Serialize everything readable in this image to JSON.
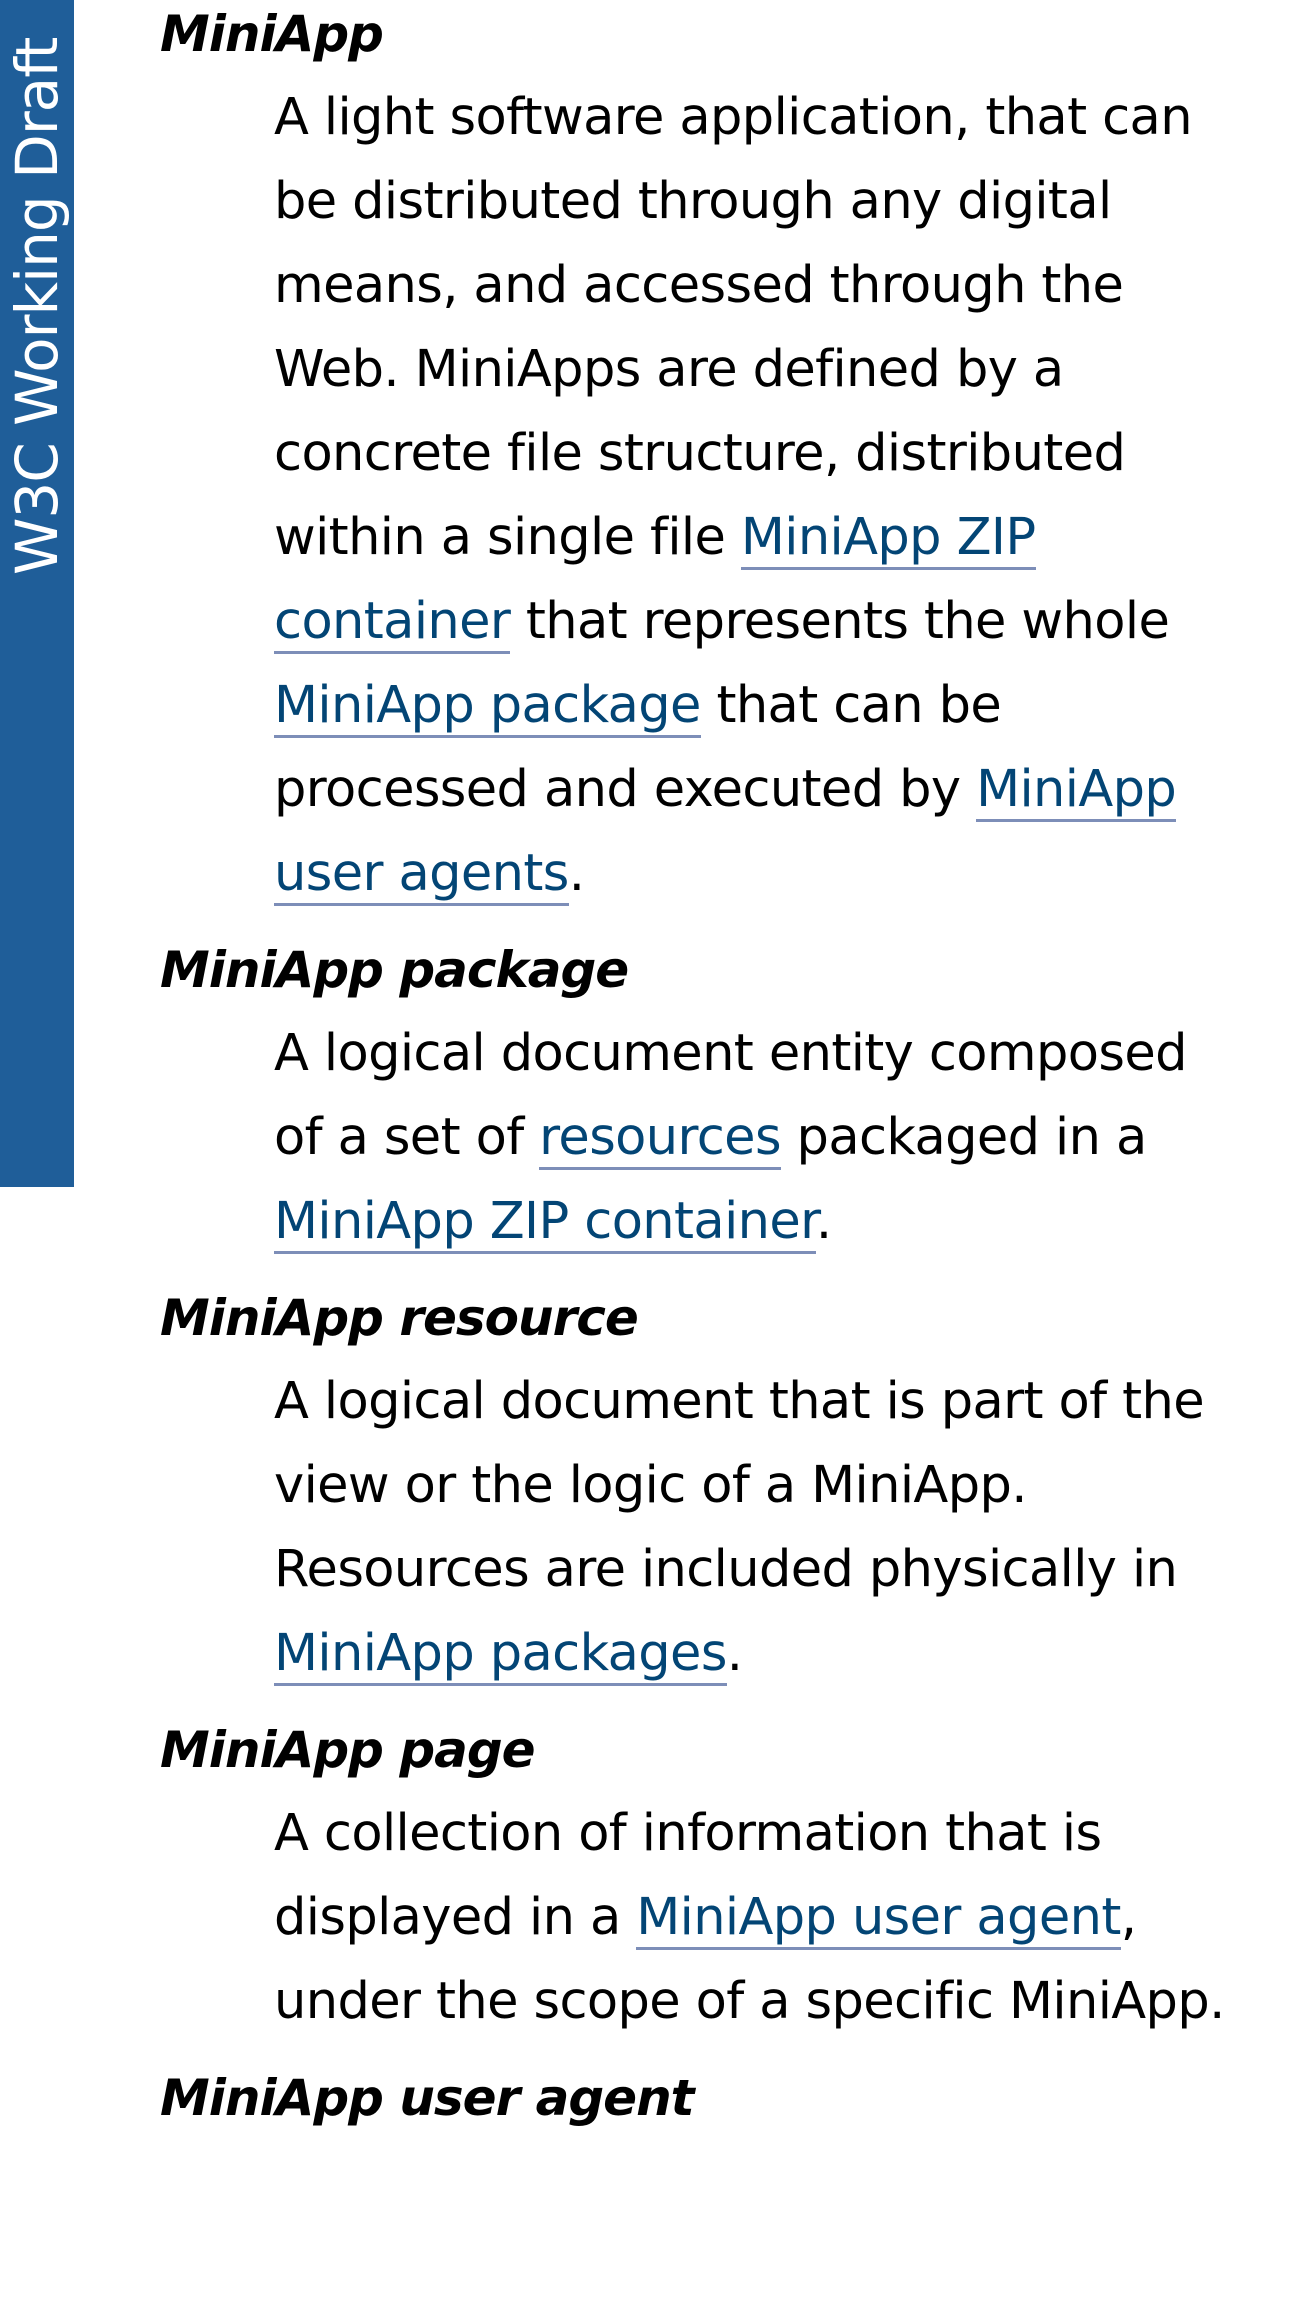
{
  "ribbon": {
    "label": "W3C Working Draft"
  },
  "terms": [
    {
      "term": "MiniApp",
      "parts": [
        {
          "text": "A light software application, that can be distributed through any digital means, and accessed through the Web. MiniApps are defined by a concrete file structure, distributed within a single file "
        },
        {
          "link": "MiniApp ZIP container"
        },
        {
          "text": " that represents the whole "
        },
        {
          "link": "MiniApp package"
        },
        {
          "text": " that can be processed and executed by "
        },
        {
          "link": "MiniApp user agents"
        },
        {
          "text": "."
        }
      ]
    },
    {
      "term": "MiniApp package",
      "parts": [
        {
          "text": "A logical document entity composed of a set of "
        },
        {
          "link": "resources"
        },
        {
          "text": " packaged in a "
        },
        {
          "link": "MiniApp ZIP container"
        },
        {
          "text": "."
        }
      ]
    },
    {
      "term": "MiniApp resource",
      "parts": [
        {
          "text": "A logical document that is part of the view or the logic of a MiniApp. Resources are included physically in "
        },
        {
          "link": "MiniApp packages"
        },
        {
          "text": "."
        }
      ]
    },
    {
      "term": "MiniApp page",
      "parts": [
        {
          "text": "A collection of information that is displayed in a "
        },
        {
          "link": "MiniApp user agent"
        },
        {
          "text": ", under the scope of a specific MiniApp."
        }
      ]
    },
    {
      "term": "MiniApp user agent",
      "parts": []
    }
  ]
}
